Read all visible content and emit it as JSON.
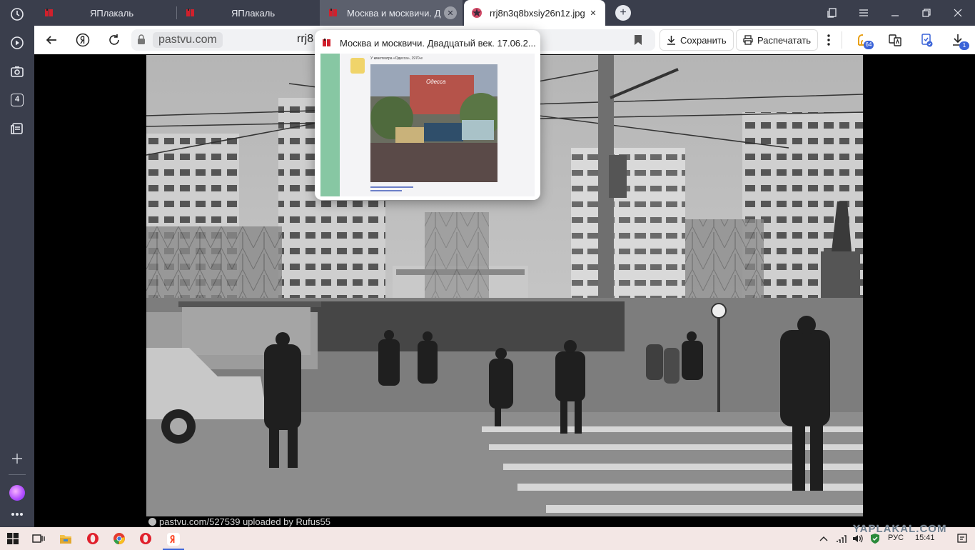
{
  "tabs": [
    {
      "title": "ЯПлакаль",
      "state": "normal"
    },
    {
      "title": "ЯПлакаль",
      "state": "normal"
    },
    {
      "title": "Москва и москвичи. Д",
      "state": "hover"
    },
    {
      "title": "rrj8n3q8bxsiy26n1z.jpg",
      "state": "active"
    }
  ],
  "toolbar": {
    "domain": "pastvu.com",
    "page_title_partial": "rrj8",
    "save_label": "Сохранить",
    "print_label": "Распечатать",
    "badge_cashback": "64",
    "badge_downloads": "1"
  },
  "sidebar": {
    "tabs_count": "4"
  },
  "preview": {
    "title": "Москва и москвичи. Двадцатый век. 17.06.2...",
    "thumb_caption": "У кинотеатра «Одесса», 1970-е",
    "thumb_sign": "Одесса"
  },
  "photo": {
    "caption": "pastvu.com/527539  uploaded by Rufus55"
  },
  "taskbar": {
    "language": "РУС",
    "time": "15:41"
  },
  "watermark": "YAPLAKAL.COM",
  "colors": {
    "sidebar": "#3a3e4c",
    "tab_active": "#ffffff",
    "tab_hover": "#5c606d",
    "taskbar": "#f3e7e5",
    "accent_yandex": "#fc3f1d"
  }
}
